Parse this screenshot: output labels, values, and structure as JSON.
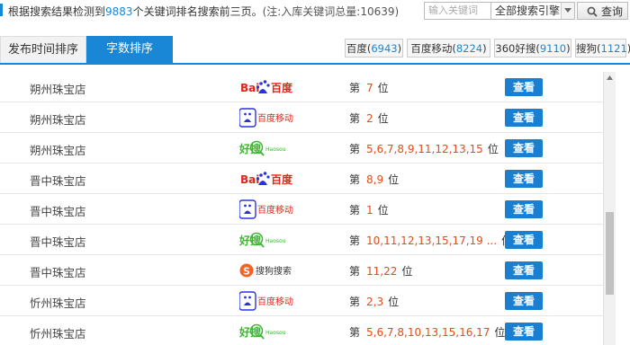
{
  "header": {
    "summary_prefix": "根据搜索结果检测到",
    "keyword_count": "9883",
    "summary_suffix": "个关键词排名搜索前三页。",
    "note": "(注:入库关键词总量:10639)",
    "keyword_input_placeholder": "输入关键词",
    "engine_select_value": "全部搜索引擎",
    "query_button": "查询"
  },
  "tabs": [
    {
      "label": "发布时间排序",
      "active": false
    },
    {
      "label": "字数排序",
      "active": true
    }
  ],
  "engine_filters": [
    {
      "name": "百度",
      "count": "6943"
    },
    {
      "name": "百度移动",
      "count": "8224"
    },
    {
      "name": "360好搜",
      "count": "9110"
    },
    {
      "name": "搜狗",
      "count": "1121"
    }
  ],
  "rows": [
    {
      "keyword": "朔州珠宝店",
      "engine": "baidu",
      "rank_prefix": "第",
      "positions": "7",
      "rank_suffix": "位",
      "action": "查看"
    },
    {
      "keyword": "朔州珠宝店",
      "engine": "baidu-mobile",
      "rank_prefix": "第",
      "positions": "2",
      "rank_suffix": "位",
      "action": "查看"
    },
    {
      "keyword": "朔州珠宝店",
      "engine": "haosou",
      "rank_prefix": "第",
      "positions": "5,6,7,8,9,11,12,13,15",
      "rank_suffix": "位",
      "action": "查看"
    },
    {
      "keyword": "晋中珠宝店",
      "engine": "baidu",
      "rank_prefix": "第",
      "positions": "8,9",
      "rank_suffix": "位",
      "action": "查看"
    },
    {
      "keyword": "晋中珠宝店",
      "engine": "baidu-mobile",
      "rank_prefix": "第",
      "positions": "1",
      "rank_suffix": "位",
      "action": "查看"
    },
    {
      "keyword": "晋中珠宝店",
      "engine": "haosou",
      "rank_prefix": "第",
      "positions": "10,11,12,13,15,17,19 ...",
      "rank_suffix": "位",
      "action": "查看"
    },
    {
      "keyword": "晋中珠宝店",
      "engine": "sogou",
      "rank_prefix": "第",
      "positions": "11,22",
      "rank_suffix": "位",
      "action": "查看"
    },
    {
      "keyword": "忻州珠宝店",
      "engine": "baidu-mobile",
      "rank_prefix": "第",
      "positions": "2,3",
      "rank_suffix": "位",
      "action": "查看"
    },
    {
      "keyword": "忻州珠宝店",
      "engine": "haosou",
      "rank_prefix": "第",
      "positions": "5,6,7,8,10,13,15,16,17",
      "rank_suffix": "位",
      "action": "查看"
    }
  ],
  "logos": {
    "baidu": {
      "latin": "Bai",
      "cn": "百度"
    },
    "baidu-mobile": {
      "cn": "百度移动"
    },
    "haosou": {
      "cn": "好搜",
      "latin": "Haosou"
    },
    "sogou": {
      "cn": "搜狗搜索"
    }
  },
  "colors": {
    "accent": "#1a87d6",
    "rank_number": "#e64a19",
    "view_button": "#1a7fd1",
    "baidu_red": "#e1251b",
    "baidu_blue": "#2932e1",
    "haosou_green": "#3fb436"
  }
}
